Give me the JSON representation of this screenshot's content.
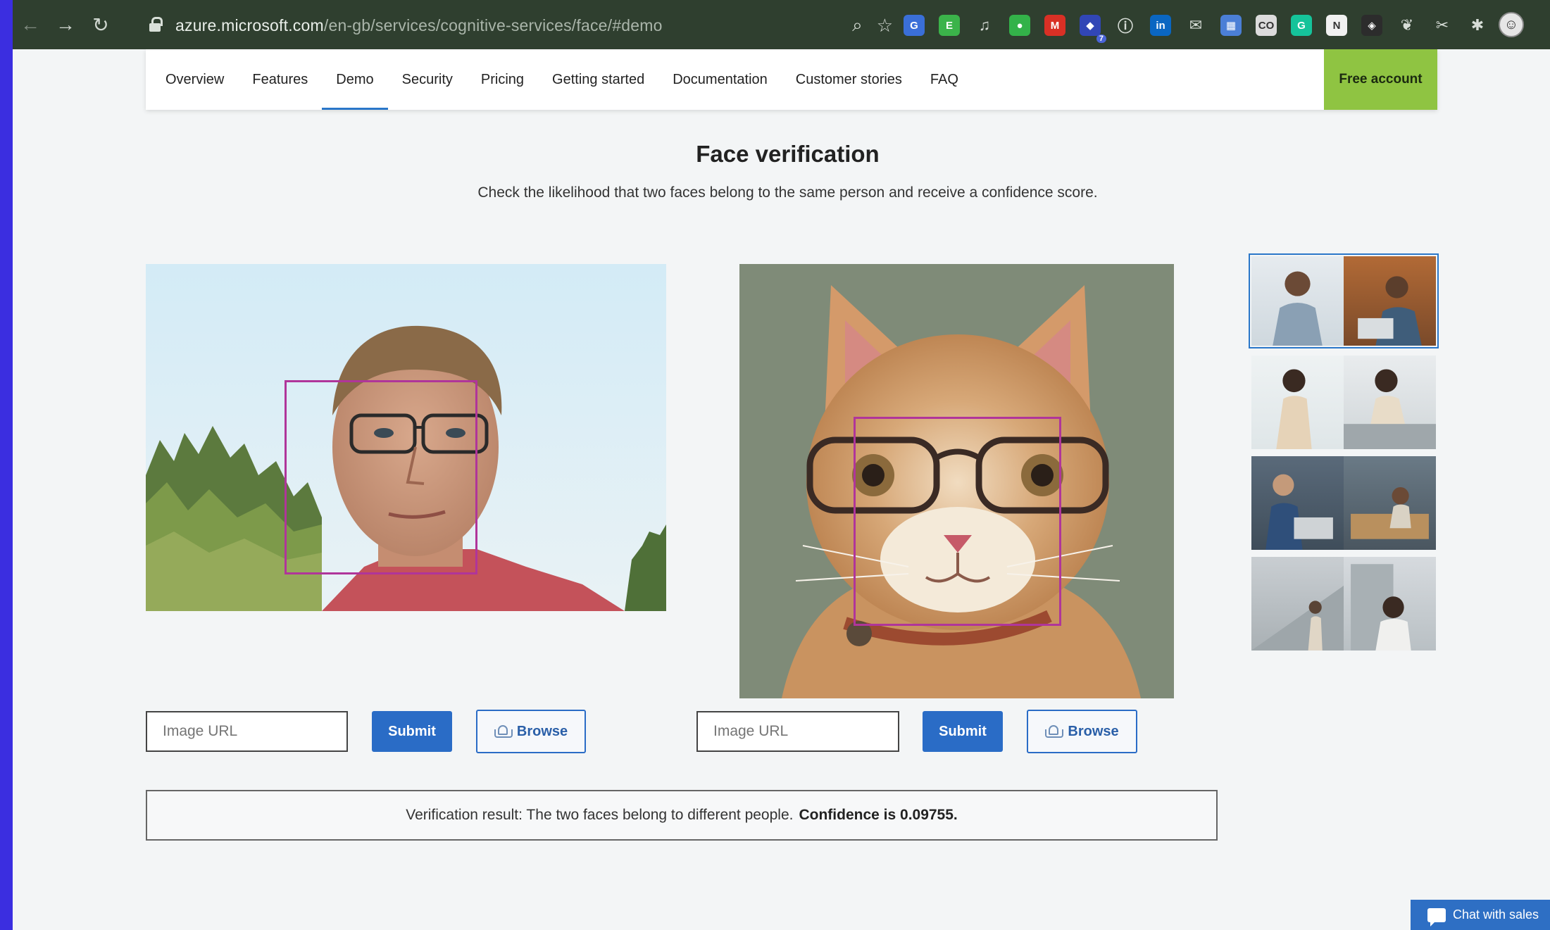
{
  "browser": {
    "url_host": "azure.microsoft.com",
    "url_path": "/en-gb/services/cognitive-services/face/#demo",
    "extensions": [
      {
        "name": "translate-icon",
        "bg": "#3a6fd8",
        "glyph": "G"
      },
      {
        "name": "evernote-icon",
        "bg": "#3bb34a",
        "glyph": "E"
      },
      {
        "name": "headphones-icon",
        "bg": "transparent",
        "glyph": "♫"
      },
      {
        "name": "green-dot-icon",
        "bg": "#33b249",
        "glyph": "●"
      },
      {
        "name": "gmail-icon",
        "bg": "#d93025",
        "glyph": "M"
      },
      {
        "name": "extension-badge-icon",
        "bg": "#3146b6",
        "glyph": "◆",
        "badge": "7"
      },
      {
        "name": "circle-i-icon",
        "bg": "transparent",
        "glyph": "ⓘ"
      },
      {
        "name": "linkedin-icon",
        "bg": "#0a66c2",
        "glyph": "in"
      },
      {
        "name": "mail-icon",
        "bg": "transparent",
        "glyph": "✉"
      },
      {
        "name": "calendar-icon",
        "bg": "#4b7fd6",
        "glyph": "▦"
      },
      {
        "name": "co-icon",
        "bg": "#dcdcdc",
        "glyph": "CO"
      },
      {
        "name": "grammarly-icon",
        "bg": "#15c39a",
        "glyph": "G"
      },
      {
        "name": "notion-icon",
        "bg": "#f1f1f1",
        "glyph": "N"
      },
      {
        "name": "shield-ext-icon",
        "bg": "#2c2c2c",
        "glyph": "◈"
      },
      {
        "name": "feather-icon",
        "bg": "transparent",
        "glyph": "❦"
      },
      {
        "name": "pin-icon",
        "bg": "transparent",
        "glyph": "✂"
      },
      {
        "name": "puzzle-icon",
        "bg": "transparent",
        "glyph": "✱"
      }
    ]
  },
  "subnav": {
    "items": [
      {
        "label": "Overview"
      },
      {
        "label": "Features"
      },
      {
        "label": "Demo",
        "active": true
      },
      {
        "label": "Security"
      },
      {
        "label": "Pricing"
      },
      {
        "label": "Getting started"
      },
      {
        "label": "Documentation"
      },
      {
        "label": "Customer stories"
      },
      {
        "label": "FAQ"
      }
    ],
    "cta": "Free account"
  },
  "hero": {
    "title": "Face verification",
    "subtitle": "Check the likelihood that two faces belong to the same person and receive a confidence score."
  },
  "left": {
    "placeholder": "Image URL",
    "submit": "Submit",
    "browse": "Browse"
  },
  "right": {
    "placeholder": "Image URL",
    "submit": "Submit",
    "browse": "Browse"
  },
  "result": {
    "text": "Verification result: The two faces belong to different people.",
    "confidence": "Confidence is 0.09755."
  },
  "chat": {
    "label": "Chat with sales"
  },
  "colors": {
    "accent": "#2a6cc6",
    "cta": "#8fc442",
    "face_box": "#b0359a"
  }
}
